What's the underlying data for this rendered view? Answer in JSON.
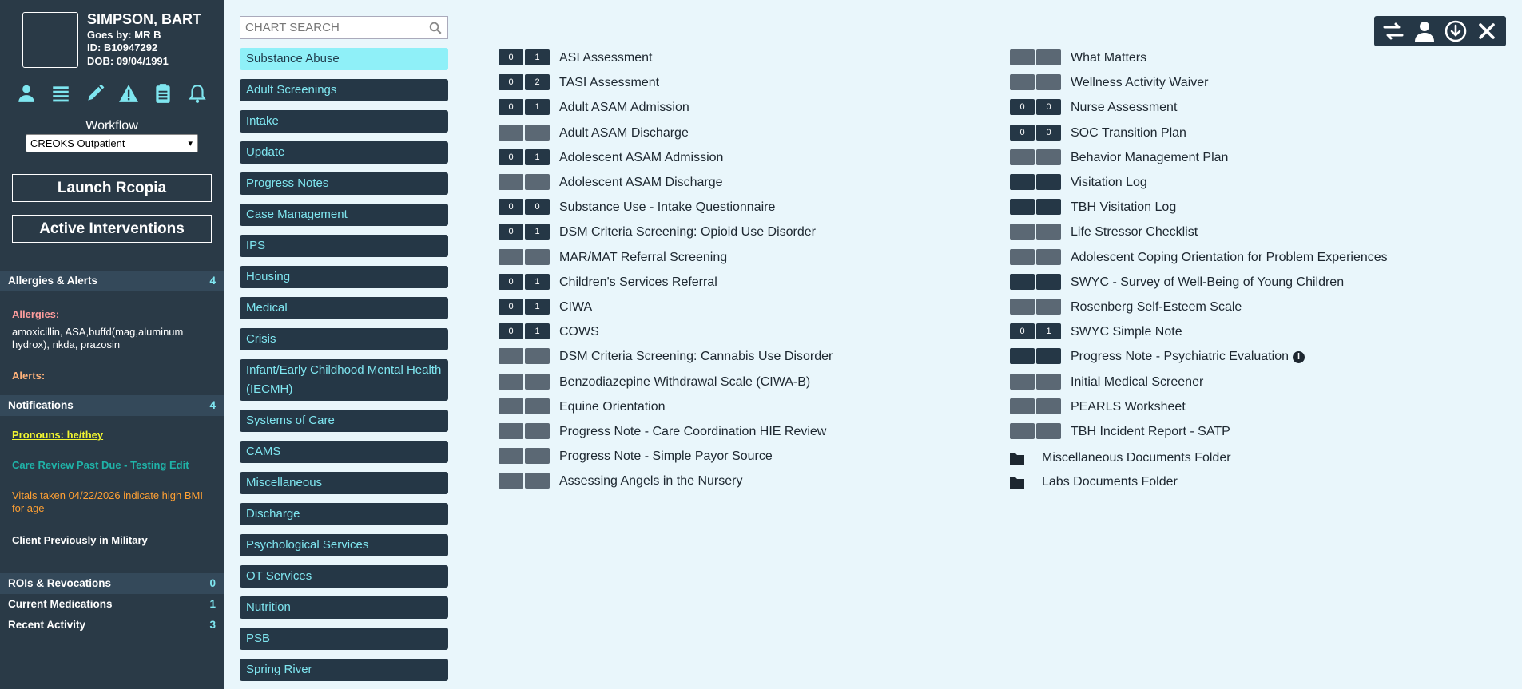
{
  "client": {
    "name": "SIMPSON, BART",
    "goes_by": "Goes by: MR B",
    "id": "ID: B10947292",
    "dob": "DOB: 09/04/1991"
  },
  "sidebar_icons": [
    "person-icon",
    "list-icon",
    "pencil-icon",
    "alert-icon",
    "clipboard-icon",
    "bell-icon"
  ],
  "workflow": {
    "label": "Workflow",
    "selected": "CREOKS Outpatient"
  },
  "buttons": {
    "launch": "Launch Rcopia",
    "interventions": "Active Interventions"
  },
  "allergies": {
    "header": "Allergies & Alerts",
    "count": "4",
    "allergies_label": "Allergies:",
    "allergies_text": "amoxicillin, ASA,buffd(mag,aluminum hydrox), nkda, prazosin",
    "alerts_label": "Alerts:"
  },
  "notifications": {
    "header": "Notifications",
    "count": "4",
    "items": [
      "Pronouns: he/they",
      "Care Review Past Due - Testing Edit",
      "Vitals taken 04/22/2026 indicate high BMI for age",
      "Client Previously in Military"
    ]
  },
  "summary": [
    {
      "label": "ROIs & Revocations",
      "count": "0"
    },
    {
      "label": "Current Medications",
      "count": "1"
    },
    {
      "label": "Recent Activity",
      "count": "3"
    }
  ],
  "search": {
    "placeholder": "CHART SEARCH"
  },
  "categories": [
    "Substance Abuse",
    "Adult Screenings",
    "Intake",
    "Update",
    "Progress Notes",
    "Case Management",
    "IPS",
    "Housing",
    "Medical",
    "Crisis",
    "Infant/Early Childhood Mental Health (IECMH)",
    "Systems of Care",
    "CAMS",
    "Miscellaneous",
    "Discharge",
    "Psychological Services",
    "OT Services",
    "Nutrition",
    "PSB",
    "Spring River"
  ],
  "documents_left": [
    {
      "name": "ASI Assessment",
      "c1": "0",
      "c2": "1"
    },
    {
      "name": "TASI Assessment",
      "c1": "0",
      "c2": "2"
    },
    {
      "name": "Adult ASAM Admission",
      "c1": "0",
      "c2": "1"
    },
    {
      "name": "Adult ASAM Discharge",
      "c1": "",
      "c2": ""
    },
    {
      "name": "Adolescent ASAM Admission",
      "c1": "0",
      "c2": "1"
    },
    {
      "name": "Adolescent ASAM Discharge",
      "c1": "",
      "c2": ""
    },
    {
      "name": "Substance Use - Intake Questionnaire",
      "c1": "0",
      "c2": "0"
    },
    {
      "name": "DSM Criteria Screening: Opioid Use Disorder",
      "c1": "0",
      "c2": "1"
    },
    {
      "name": "MAR/MAT Referral Screening",
      "c1": "",
      "c2": ""
    },
    {
      "name": "Children's Services Referral",
      "c1": "0",
      "c2": "1"
    },
    {
      "name": "CIWA",
      "c1": "0",
      "c2": "1"
    },
    {
      "name": "COWS",
      "c1": "0",
      "c2": "1"
    },
    {
      "name": "DSM Criteria Screening: Cannabis Use Disorder",
      "c1": "",
      "c2": ""
    },
    {
      "name": "Benzodiazepine Withdrawal Scale (CIWA-B)",
      "c1": "",
      "c2": ""
    },
    {
      "name": "Equine Orientation",
      "c1": "",
      "c2": ""
    },
    {
      "name": "Progress Note - Care Coordination HIE Review",
      "c1": "",
      "c2": ""
    },
    {
      "name": "Progress Note - Simple Payor Source",
      "c1": "",
      "c2": ""
    },
    {
      "name": "Assessing Angels in the Nursery",
      "c1": "",
      "c2": ""
    }
  ],
  "documents_right": [
    {
      "name": "What Matters",
      "c1": "",
      "c2": "",
      "shade": "grey"
    },
    {
      "name": "Wellness Activity Waiver",
      "c1": "",
      "c2": "",
      "shade": "grey"
    },
    {
      "name": "Nurse Assessment",
      "c1": "0",
      "c2": "0",
      "shade": "dark"
    },
    {
      "name": "SOC Transition Plan",
      "c1": "0",
      "c2": "0",
      "shade": "dark"
    },
    {
      "name": "Behavior Management Plan",
      "c1": "",
      "c2": "",
      "shade": "grey"
    },
    {
      "name": "Visitation Log",
      "c1": "",
      "c2": "",
      "shade": "dark"
    },
    {
      "name": "TBH Visitation Log",
      "c1": "",
      "c2": "",
      "shade": "dark"
    },
    {
      "name": "Life Stressor Checklist",
      "c1": "",
      "c2": "",
      "shade": "grey"
    },
    {
      "name": "Adolescent Coping Orientation for Problem Experiences",
      "c1": "",
      "c2": "",
      "shade": "grey"
    },
    {
      "name": "SWYC - Survey of Well-Being of Young Children",
      "c1": "",
      "c2": "",
      "shade": "dark"
    },
    {
      "name": "Rosenberg Self-Esteem Scale",
      "c1": "",
      "c2": "",
      "shade": "grey"
    },
    {
      "name": "SWYC Simple Note",
      "c1": "0",
      "c2": "1",
      "shade": "dark"
    },
    {
      "name": "Progress Note - Psychiatric Evaluation",
      "c1": "",
      "c2": "",
      "shade": "dark",
      "info": "i"
    },
    {
      "name": "Initial Medical Screener",
      "c1": "",
      "c2": "",
      "shade": "grey"
    },
    {
      "name": "PEARLS Worksheet",
      "c1": "",
      "c2": "",
      "shade": "grey"
    },
    {
      "name": "TBH Incident Report - SATP",
      "c1": "",
      "c2": "",
      "shade": "grey"
    }
  ],
  "folders": [
    "Miscellaneous Documents Folder",
    "Labs Documents Folder"
  ],
  "toolbar_icons": [
    "swap-icon",
    "user-icon",
    "download-icon",
    "close-icon"
  ],
  "colors": {
    "sidebar_bg": "#2a3a47",
    "accent": "#7fe6f0",
    "page_bg": "#e9f6fb"
  }
}
